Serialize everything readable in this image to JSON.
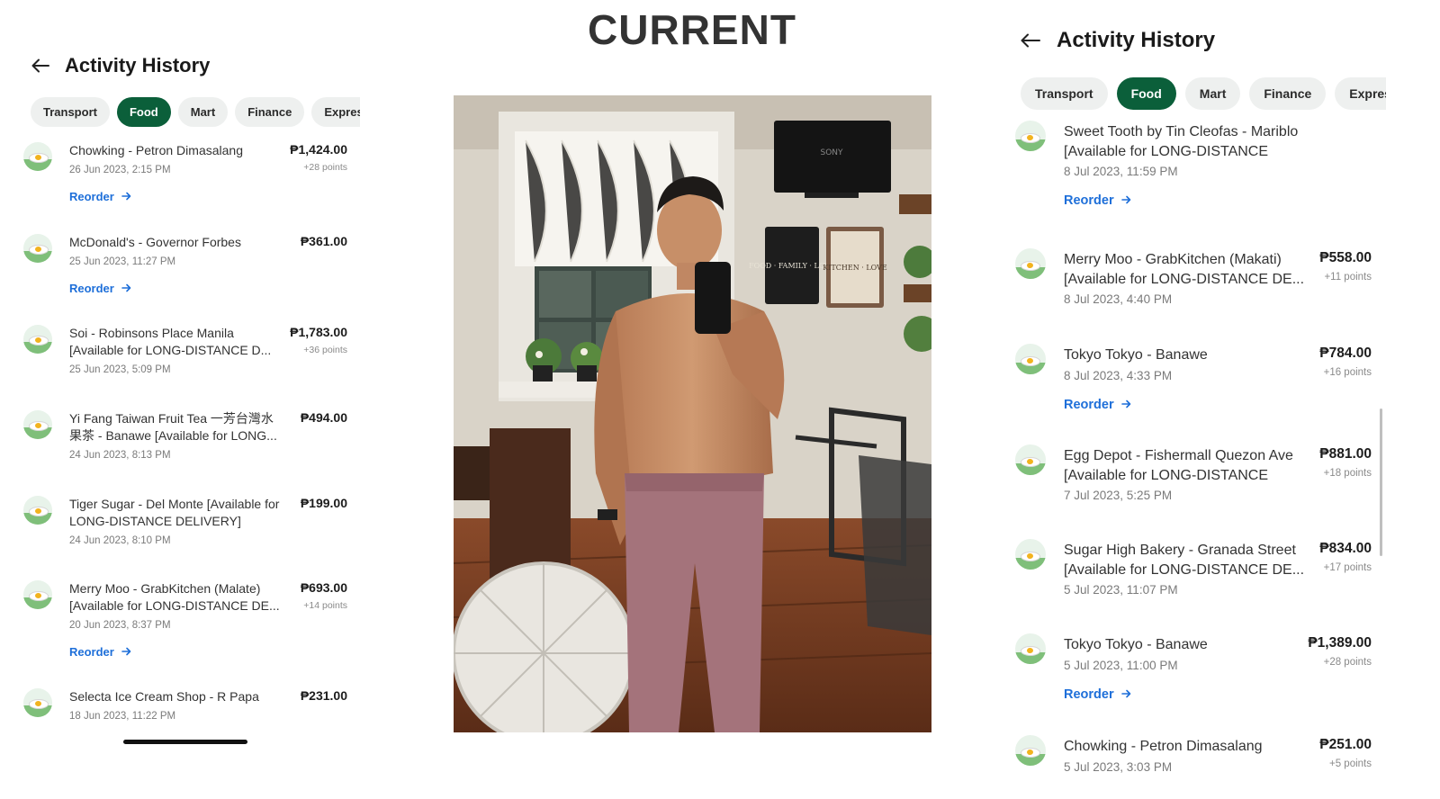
{
  "center": {
    "heading": "CURRENT",
    "photo": {
      "wall_text_left": "FOOD · FAMILY · LOVE",
      "wall_text_right": "KITCHEN · LOVE",
      "tv_brand": "SONY"
    }
  },
  "left": {
    "title": "Activity History",
    "tabs": [
      {
        "label": "Transport",
        "active": false
      },
      {
        "label": "Food",
        "active": true
      },
      {
        "label": "Mart",
        "active": false
      },
      {
        "label": "Finance",
        "active": false
      },
      {
        "label": "Express",
        "active": false
      }
    ],
    "orders": [
      {
        "name": "Chowking - Petron Dimasalang",
        "date": "26 Jun 2023, 2:15 PM",
        "price": "₱1,424.00",
        "points": "+28 points",
        "reorder": "Reorder"
      },
      {
        "name": "McDonald's - Governor Forbes",
        "date": "25 Jun 2023, 11:27 PM",
        "price": "₱361.00",
        "points": "",
        "reorder": "Reorder"
      },
      {
        "name": "Soi - Robinsons Place Manila [Available for LONG-DISTANCE D...",
        "date": "25 Jun 2023, 5:09 PM",
        "price": "₱1,783.00",
        "points": "+36 points",
        "reorder": ""
      },
      {
        "name": "Yi Fang Taiwan Fruit Tea 一芳台灣水果茶 - Banawe [Available for LONG...",
        "date": "24 Jun 2023, 8:13 PM",
        "price": "₱494.00",
        "points": "",
        "reorder": ""
      },
      {
        "name": "Tiger Sugar - Del Monte [Available for LONG-DISTANCE DELIVERY]",
        "date": "24 Jun 2023, 8:10 PM",
        "price": "₱199.00",
        "points": "",
        "reorder": ""
      },
      {
        "name": "Merry Moo - GrabKitchen (Malate) [Available for LONG-DISTANCE DE...",
        "date": "20 Jun 2023, 8:37 PM",
        "price": "₱693.00",
        "points": "+14 points",
        "reorder": "Reorder"
      },
      {
        "name": "Selecta Ice Cream Shop - R Papa",
        "date": "18 Jun 2023, 11:22 PM",
        "price": "₱231.00",
        "points": "",
        "reorder": ""
      }
    ]
  },
  "right": {
    "title": "Activity History",
    "tabs": [
      {
        "label": "Transport",
        "active": false
      },
      {
        "label": "Food",
        "active": true
      },
      {
        "label": "Mart",
        "active": false
      },
      {
        "label": "Finance",
        "active": false
      },
      {
        "label": "Express",
        "active": false
      }
    ],
    "orders": [
      {
        "name": "Sweet Tooth by Tin Cleofas - Mariblo [Available for LONG-DISTANCE DELIVERY]",
        "date": "8 Jul 2023, 11:59 PM",
        "price": "",
        "points": "",
        "reorder": "Reorder"
      },
      {
        "name": "Merry Moo - GrabKitchen (Makati) [Available for LONG-DISTANCE DE...",
        "date": "8 Jul 2023, 4:40 PM",
        "price": "₱558.00",
        "points": "+11 points",
        "reorder": ""
      },
      {
        "name": "Tokyo Tokyo - Banawe",
        "date": "8 Jul 2023, 4:33 PM",
        "price": "₱784.00",
        "points": "+16 points",
        "reorder": "Reorder"
      },
      {
        "name": "Egg Depot - Fishermall Quezon Ave [Available for LONG-DISTANCE DEL...",
        "date": "7 Jul 2023, 5:25 PM",
        "price": "₱881.00",
        "points": "+18 points",
        "reorder": ""
      },
      {
        "name": "Sugar High Bakery - Granada Street [Available for LONG-DISTANCE DE...",
        "date": "5 Jul 2023, 11:07 PM",
        "price": "₱834.00",
        "points": "+17 points",
        "reorder": ""
      },
      {
        "name": "Tokyo Tokyo - Banawe",
        "date": "5 Jul 2023, 11:00 PM",
        "price": "₱1,389.00",
        "points": "+28 points",
        "reorder": "Reorder"
      },
      {
        "name": "Chowking - Petron Dimasalang",
        "date": "5 Jul 2023, 3:03 PM",
        "price": "₱251.00",
        "points": "+5 points",
        "reorder": ""
      }
    ]
  },
  "colors": {
    "active_tab": "#0b5f3a",
    "tab_bg": "#eef0ef",
    "link": "#1e6fd9"
  },
  "icons": {
    "back": "arrow-left-icon",
    "reorder": "arrow-right-icon",
    "merchant": "food-merchant-icon"
  }
}
